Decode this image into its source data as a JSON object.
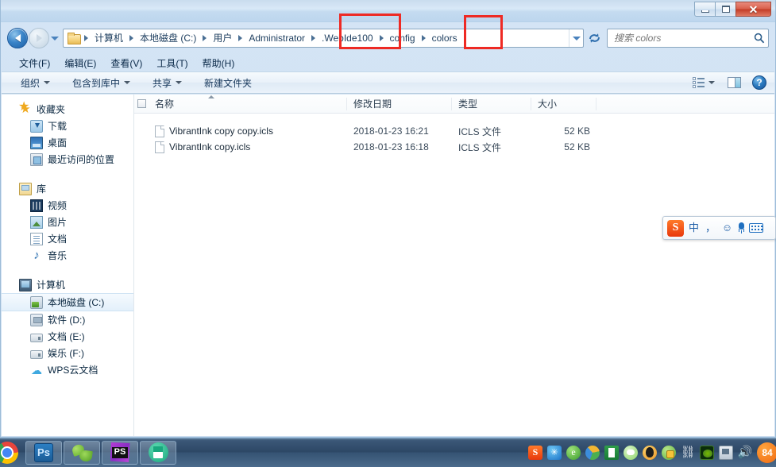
{
  "window": {
    "titlebar_text": "",
    "controls": {
      "minimize": "–",
      "maximize": "□",
      "close": "✕"
    }
  },
  "address_bar": {
    "back_tooltip": "后退",
    "forward_tooltip": "前进",
    "history_dropdown": "▼",
    "folder_icon": "folder-icon",
    "breadcrumbs": [
      {
        "label": "计算机",
        "highlighted": false
      },
      {
        "label": "本地磁盘 (C:)",
        "highlighted": false
      },
      {
        "label": "用户",
        "highlighted": false
      },
      {
        "label": "Administrator",
        "highlighted": false
      },
      {
        "label": ".WebIde100",
        "highlighted": true
      },
      {
        "label": "config",
        "highlighted": false
      },
      {
        "label": "colors",
        "highlighted": true
      }
    ],
    "refresh_label": "刷新",
    "search": {
      "placeholder": "搜索 colors",
      "value": ""
    }
  },
  "menu": {
    "items": [
      {
        "label": "文件(F)"
      },
      {
        "label": "编辑(E)"
      },
      {
        "label": "查看(V)"
      },
      {
        "label": "工具(T)"
      },
      {
        "label": "帮助(H)"
      }
    ]
  },
  "command_bar": {
    "items": [
      {
        "label": "组织",
        "has_caret": true
      },
      {
        "label": "包含到库中",
        "has_caret": true
      },
      {
        "label": "共享",
        "has_caret": true
      },
      {
        "label": "新建文件夹",
        "has_caret": false
      }
    ],
    "right_icons": [
      {
        "name": "view-options-icon"
      },
      {
        "name": "view-dropdown-caret"
      },
      {
        "name": "preview-pane-icon"
      },
      {
        "name": "help-icon",
        "label": "?"
      }
    ]
  },
  "nav_pane": {
    "groups": [
      {
        "root": {
          "label": "收藏夹",
          "icon": "star-icon"
        },
        "children": [
          {
            "label": "下载",
            "icon": "download-icon"
          },
          {
            "label": "桌面",
            "icon": "desktop-icon"
          },
          {
            "label": "最近访问的位置",
            "icon": "recent-places-icon"
          }
        ]
      },
      {
        "root": {
          "label": "库",
          "icon": "library-icon"
        },
        "children": [
          {
            "label": "视频",
            "icon": "video-icon"
          },
          {
            "label": "图片",
            "icon": "pictures-icon"
          },
          {
            "label": "文档",
            "icon": "documents-icon"
          },
          {
            "label": "音乐",
            "icon": "music-icon"
          }
        ]
      },
      {
        "root": {
          "label": "计算机",
          "icon": "computer-icon"
        },
        "children": [
          {
            "label": "本地磁盘 (C:)",
            "icon": "hard-disk-icon",
            "selected": true
          },
          {
            "label": "软件 (D:)",
            "icon": "hard-disk-icon",
            "selected": false
          },
          {
            "label": "文档 (E:)",
            "icon": "drive-icon",
            "selected": false
          },
          {
            "label": "娱乐 (F:)",
            "icon": "drive-icon",
            "selected": false
          },
          {
            "label": "WPS云文档",
            "icon": "cloud-icon",
            "selected": false
          }
        ]
      }
    ]
  },
  "file_list": {
    "columns": [
      {
        "key": "name",
        "label": "名称",
        "sorted": "asc"
      },
      {
        "key": "date",
        "label": "修改日期"
      },
      {
        "key": "type",
        "label": "类型"
      },
      {
        "key": "size",
        "label": "大小"
      }
    ],
    "rows": [
      {
        "name": "VibrantInk copy copy.icls",
        "date": "2018-01-23 16:21",
        "type": "ICLS 文件",
        "size": "52 KB"
      },
      {
        "name": "VibrantInk copy.icls",
        "date": "2018-01-23 16:18",
        "type": "ICLS 文件",
        "size": "52 KB"
      }
    ]
  },
  "annotations": {
    "boxes": [
      {
        "target": ".WebIde100",
        "color": "#ee2a24"
      },
      {
        "target": "colors",
        "color": "#ee2a24"
      }
    ]
  },
  "ime_bar": {
    "logo": "S",
    "mode": "中",
    "punctuation": "，",
    "emoji": "☺",
    "microphone": "mic-icon",
    "keyboard": "keyboard-icon"
  },
  "taskbar": {
    "start_icon": "chrome-icon",
    "buttons": [
      {
        "name": "photoshop-taskbar-button",
        "label": "Ps"
      },
      {
        "name": "green-app-taskbar-button",
        "label": ""
      },
      {
        "name": "phpstorm-taskbar-button",
        "label": "PS"
      },
      {
        "name": "wps-taskbar-button",
        "label": ""
      }
    ],
    "tray": [
      {
        "name": "sogou-tray-icon",
        "label": "S"
      },
      {
        "name": "blue-star-tray-icon",
        "label": "✳"
      },
      {
        "name": "green-e-tray-icon",
        "label": "e"
      },
      {
        "name": "drive-tray-icon",
        "label": ""
      },
      {
        "name": "green-app-tray-icon",
        "label": ""
      },
      {
        "name": "bubble-tray-icon",
        "label": ""
      },
      {
        "name": "qq-tray-icon",
        "label": ""
      },
      {
        "name": "security-tray-icon",
        "label": ""
      },
      {
        "name": "link-tray-icon",
        "label": "⛓"
      },
      {
        "name": "nvidia-tray-icon",
        "label": ""
      },
      {
        "name": "network-tray-icon",
        "label": ""
      },
      {
        "name": "volume-tray-icon",
        "label": "🔊"
      },
      {
        "name": "notification-badge",
        "label": "84"
      }
    ]
  }
}
